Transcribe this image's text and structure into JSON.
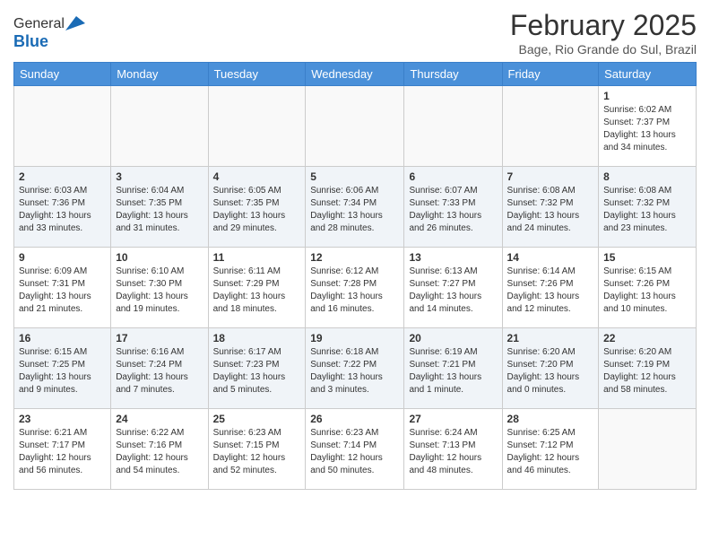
{
  "header": {
    "logo_general": "General",
    "logo_blue": "Blue",
    "main_title": "February 2025",
    "subtitle": "Bage, Rio Grande do Sul, Brazil"
  },
  "weekdays": [
    "Sunday",
    "Monday",
    "Tuesday",
    "Wednesday",
    "Thursday",
    "Friday",
    "Saturday"
  ],
  "weeks": [
    [
      {
        "day": "",
        "info": ""
      },
      {
        "day": "",
        "info": ""
      },
      {
        "day": "",
        "info": ""
      },
      {
        "day": "",
        "info": ""
      },
      {
        "day": "",
        "info": ""
      },
      {
        "day": "",
        "info": ""
      },
      {
        "day": "1",
        "info": "Sunrise: 6:02 AM\nSunset: 7:37 PM\nDaylight: 13 hours\nand 34 minutes."
      }
    ],
    [
      {
        "day": "2",
        "info": "Sunrise: 6:03 AM\nSunset: 7:36 PM\nDaylight: 13 hours\nand 33 minutes."
      },
      {
        "day": "3",
        "info": "Sunrise: 6:04 AM\nSunset: 7:35 PM\nDaylight: 13 hours\nand 31 minutes."
      },
      {
        "day": "4",
        "info": "Sunrise: 6:05 AM\nSunset: 7:35 PM\nDaylight: 13 hours\nand 29 minutes."
      },
      {
        "day": "5",
        "info": "Sunrise: 6:06 AM\nSunset: 7:34 PM\nDaylight: 13 hours\nand 28 minutes."
      },
      {
        "day": "6",
        "info": "Sunrise: 6:07 AM\nSunset: 7:33 PM\nDaylight: 13 hours\nand 26 minutes."
      },
      {
        "day": "7",
        "info": "Sunrise: 6:08 AM\nSunset: 7:32 PM\nDaylight: 13 hours\nand 24 minutes."
      },
      {
        "day": "8",
        "info": "Sunrise: 6:08 AM\nSunset: 7:32 PM\nDaylight: 13 hours\nand 23 minutes."
      }
    ],
    [
      {
        "day": "9",
        "info": "Sunrise: 6:09 AM\nSunset: 7:31 PM\nDaylight: 13 hours\nand 21 minutes."
      },
      {
        "day": "10",
        "info": "Sunrise: 6:10 AM\nSunset: 7:30 PM\nDaylight: 13 hours\nand 19 minutes."
      },
      {
        "day": "11",
        "info": "Sunrise: 6:11 AM\nSunset: 7:29 PM\nDaylight: 13 hours\nand 18 minutes."
      },
      {
        "day": "12",
        "info": "Sunrise: 6:12 AM\nSunset: 7:28 PM\nDaylight: 13 hours\nand 16 minutes."
      },
      {
        "day": "13",
        "info": "Sunrise: 6:13 AM\nSunset: 7:27 PM\nDaylight: 13 hours\nand 14 minutes."
      },
      {
        "day": "14",
        "info": "Sunrise: 6:14 AM\nSunset: 7:26 PM\nDaylight: 13 hours\nand 12 minutes."
      },
      {
        "day": "15",
        "info": "Sunrise: 6:15 AM\nSunset: 7:26 PM\nDaylight: 13 hours\nand 10 minutes."
      }
    ],
    [
      {
        "day": "16",
        "info": "Sunrise: 6:15 AM\nSunset: 7:25 PM\nDaylight: 13 hours\nand 9 minutes."
      },
      {
        "day": "17",
        "info": "Sunrise: 6:16 AM\nSunset: 7:24 PM\nDaylight: 13 hours\nand 7 minutes."
      },
      {
        "day": "18",
        "info": "Sunrise: 6:17 AM\nSunset: 7:23 PM\nDaylight: 13 hours\nand 5 minutes."
      },
      {
        "day": "19",
        "info": "Sunrise: 6:18 AM\nSunset: 7:22 PM\nDaylight: 13 hours\nand 3 minutes."
      },
      {
        "day": "20",
        "info": "Sunrise: 6:19 AM\nSunset: 7:21 PM\nDaylight: 13 hours\nand 1 minute."
      },
      {
        "day": "21",
        "info": "Sunrise: 6:20 AM\nSunset: 7:20 PM\nDaylight: 13 hours\nand 0 minutes."
      },
      {
        "day": "22",
        "info": "Sunrise: 6:20 AM\nSunset: 7:19 PM\nDaylight: 12 hours\nand 58 minutes."
      }
    ],
    [
      {
        "day": "23",
        "info": "Sunrise: 6:21 AM\nSunset: 7:17 PM\nDaylight: 12 hours\nand 56 minutes."
      },
      {
        "day": "24",
        "info": "Sunrise: 6:22 AM\nSunset: 7:16 PM\nDaylight: 12 hours\nand 54 minutes."
      },
      {
        "day": "25",
        "info": "Sunrise: 6:23 AM\nSunset: 7:15 PM\nDaylight: 12 hours\nand 52 minutes."
      },
      {
        "day": "26",
        "info": "Sunrise: 6:23 AM\nSunset: 7:14 PM\nDaylight: 12 hours\nand 50 minutes."
      },
      {
        "day": "27",
        "info": "Sunrise: 6:24 AM\nSunset: 7:13 PM\nDaylight: 12 hours\nand 48 minutes."
      },
      {
        "day": "28",
        "info": "Sunrise: 6:25 AM\nSunset: 7:12 PM\nDaylight: 12 hours\nand 46 minutes."
      },
      {
        "day": "",
        "info": ""
      }
    ]
  ]
}
